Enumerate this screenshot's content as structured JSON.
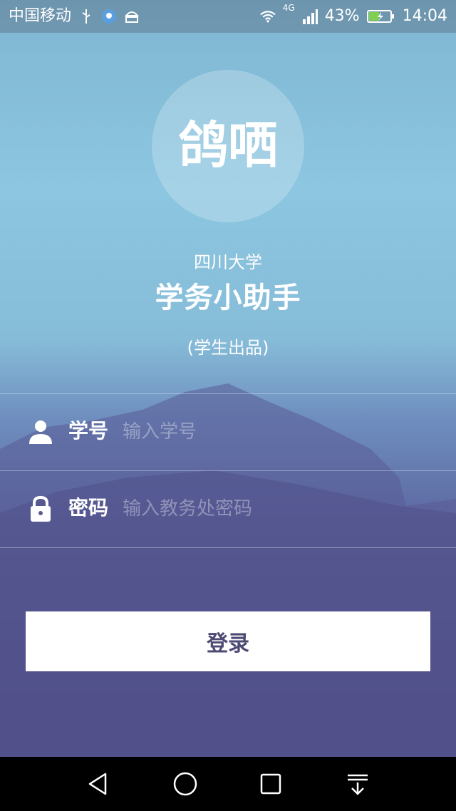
{
  "status_bar": {
    "carrier": "中国移动",
    "battery": "43%",
    "time": "14:04",
    "network": "4G",
    "icons": [
      "usb-icon",
      "app-notify-icon",
      "android-icon",
      "wifi-icon",
      "signal-icon",
      "battery-charging-icon"
    ]
  },
  "app": {
    "logo_text": "鸽哂",
    "university": "四川大学",
    "title": "学务小助手",
    "note": "(学生出品)"
  },
  "form": {
    "student_id": {
      "label": "学号",
      "placeholder": "输入学号",
      "value": "",
      "icon": "person-icon"
    },
    "password": {
      "label": "密码",
      "placeholder": "输入教务处密码",
      "value": "",
      "icon": "lock-icon"
    },
    "login_label": "登录"
  },
  "nav_bar": {
    "buttons": [
      "back-icon",
      "home-icon",
      "recents-icon",
      "notification-pulldown-icon"
    ]
  },
  "colors": {
    "button_text": "#4d4a74",
    "background_top": "#8cc6e0",
    "background_bottom": "#4a4780"
  }
}
